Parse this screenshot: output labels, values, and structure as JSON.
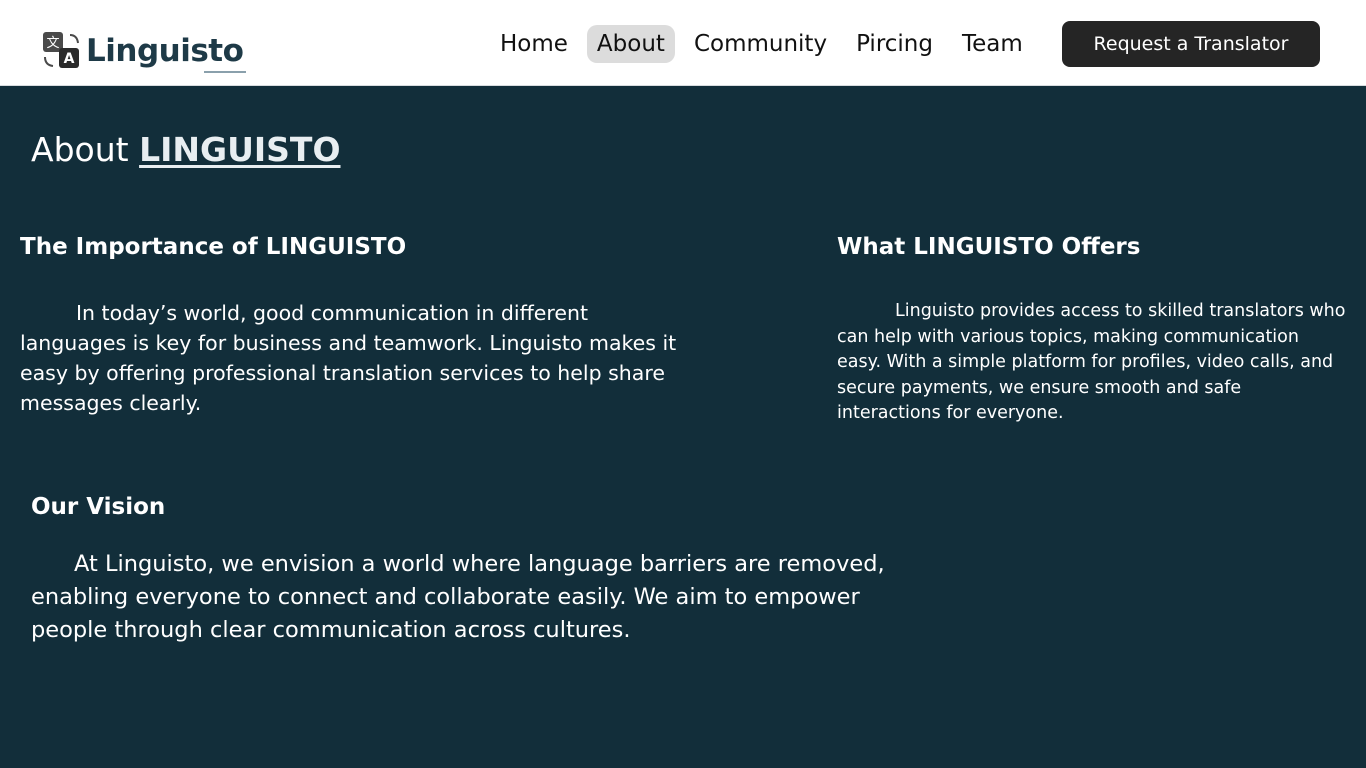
{
  "header": {
    "logo": {
      "text": "Linguisto",
      "icon": "translate-icon"
    },
    "nav": {
      "items": [
        {
          "label": "Home",
          "active": false
        },
        {
          "label": "About",
          "active": true
        },
        {
          "label": "Community",
          "active": false
        },
        {
          "label": "Pircing",
          "active": false
        },
        {
          "label": "Team",
          "active": false
        }
      ]
    },
    "cta_label": "Request a Translator"
  },
  "main": {
    "title_prefix": "About",
    "title_brand": "LINGUISTO",
    "sections": {
      "importance": {
        "heading": "The Importance of LINGUISTO",
        "body": "In today’s world, good communication in different languages is key for business and teamwork. Linguisto makes it easy by offering professional translation services to help share messages clearly."
      },
      "offers": {
        "heading": "What LINGUISTO Offers",
        "body": "Linguisto provides access to skilled translators who can help with various topics, making communication easy. With a simple platform for profiles, video calls, and secure payments, we ensure smooth and safe interactions for everyone."
      },
      "vision": {
        "heading": "Our Vision",
        "body": "At Linguisto, we envision a world where language barriers are removed, enabling everyone to connect and collaborate easily. We aim to empower people through clear communication across cultures."
      }
    }
  },
  "colors": {
    "background": "#122e3a",
    "header_background": "#ffffff",
    "nav_active_background": "#dcdcdc",
    "cta_background": "#252525",
    "text_light": "#ffffff",
    "logo_text": "#1e3a47"
  }
}
